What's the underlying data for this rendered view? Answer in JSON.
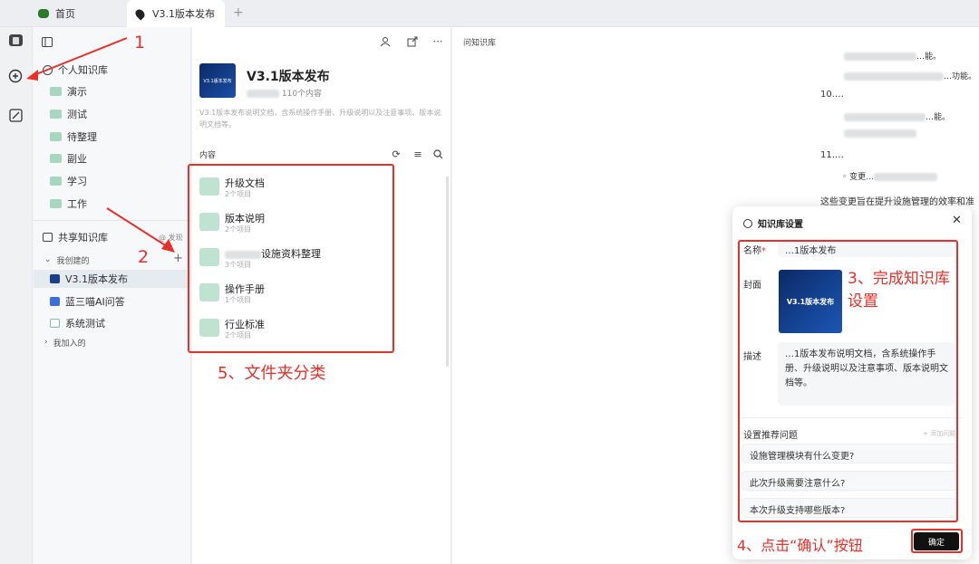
{
  "tabs": [
    {
      "label": "首页",
      "icon": "panda-icon"
    },
    {
      "label": "V3.1版本发布",
      "icon": "pin-icon"
    }
  ],
  "sidebar": {
    "personal_title": "个人知识库",
    "personal_items": [
      "演示",
      "测试",
      "待整理",
      "副业",
      "学习",
      "工作"
    ],
    "shared_title": "共享知识库",
    "discover": "@ 发现",
    "created_group": "我创建的",
    "created_items": [
      {
        "label": "V3.1版本发布",
        "color": "#1b3f8f"
      },
      {
        "label": "蓝三喵AI问答",
        "color": "#3a6fd8"
      },
      {
        "label": "系统测试",
        "color": "#7ac5a4"
      }
    ],
    "joined_group": "我加入的"
  },
  "kb": {
    "title": "V3.1版本发布",
    "cover_text": "V3.1版本发布",
    "count": "110个内容",
    "description": "V3.1版本发布说明文档，含系统操作手册、升级说明以及注意事项、版本说明文档等。",
    "content_label": "内容",
    "folders": [
      {
        "name": "升级文档",
        "count": "2个项目"
      },
      {
        "name": "版本说明",
        "count": "2个项目"
      },
      {
        "name": "设施资料整理",
        "count": "3个项目"
      },
      {
        "name": "操作手册",
        "count": "1个项目"
      },
      {
        "name": "行业标准",
        "count": "2个项目"
      }
    ]
  },
  "chat": {
    "title": "问知识库",
    "lines": [
      "…能。",
      "…功能。",
      "10.…",
      "…能。",
      "11.…",
      "变更…",
      "这些变更旨在提升设施管理的效率和准"
    ]
  },
  "modal": {
    "title": "知识库设置",
    "name_label": "名称",
    "name_value": "…1版本发布",
    "cover_label": "封面",
    "cover_text": "V3.1版本发布",
    "desc_label": "描述",
    "desc_value": "…1版本发布说明文档，含系统操作手册、升级说明以及注意事项、版本说明文档等。",
    "questions_label": "设置推荐问题",
    "add_question": "+ 添加问题",
    "questions": [
      "设施管理模块有什么变更?",
      "此次升级需要注意什么?",
      "本次升级支持哪些版本?"
    ],
    "confirm": "确定"
  },
  "annotations": {
    "a1": "1",
    "a2": "2",
    "a3": "3、完成知识库设置",
    "a4": "4、点击“确认”按钮",
    "a5": "5、文件夹分类",
    "color": "#e8302a"
  }
}
